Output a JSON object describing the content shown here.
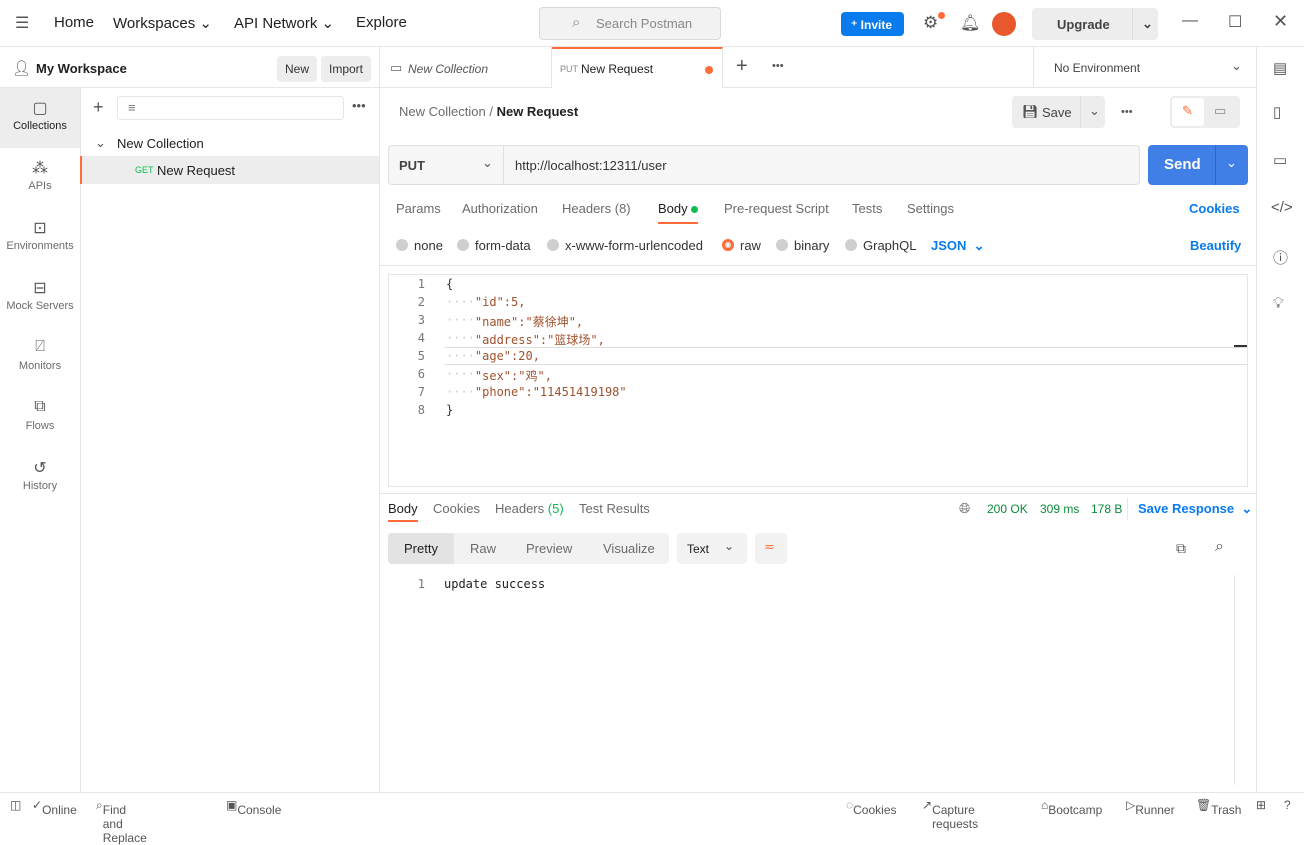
{
  "topbar": {
    "nav": [
      "Home",
      "Workspaces",
      "API Network",
      "Explore"
    ],
    "search_placeholder": "Search Postman",
    "invite": "Invite",
    "upgrade": "Upgrade"
  },
  "sidebar": {
    "workspace": "My Workspace",
    "new": "New",
    "import": "Import",
    "collection": "New Collection",
    "request_method": "GET",
    "request_name": "New Request"
  },
  "rail": [
    {
      "label": "Collections",
      "icon": "collections-icon"
    },
    {
      "label": "APIs",
      "icon": "apis-icon"
    },
    {
      "label": "Environments",
      "icon": "environments-icon"
    },
    {
      "label": "Mock Servers",
      "icon": "mock-servers-icon"
    },
    {
      "label": "Monitors",
      "icon": "monitors-icon"
    },
    {
      "label": "Flows",
      "icon": "flows-icon"
    },
    {
      "label": "History",
      "icon": "history-icon"
    }
  ],
  "tabs": [
    {
      "label": "New Collection"
    },
    {
      "method": "PUT",
      "label": "New Request"
    }
  ],
  "environment": "No Environment",
  "breadcrumb": {
    "parent": "New Collection",
    "sep": "/",
    "current": "New Request"
  },
  "save": "Save",
  "request": {
    "method": "PUT",
    "url": "http://localhost:12311/user",
    "send": "Send"
  },
  "req_tabs": [
    "Params",
    "Authorization",
    "Headers (8)",
    "Body",
    "Pre-request Script",
    "Tests",
    "Settings"
  ],
  "cookies": "Cookies",
  "body_types": [
    "none",
    "form-data",
    "x-www-form-urlencoded",
    "raw",
    "binary",
    "GraphQL"
  ],
  "body_format": "JSON",
  "beautify": "Beautify",
  "code_lines": [
    "{",
    "    \"id\":5,",
    "    \"name\":\"蔡徐坤\",",
    "    \"address\":\"篮球场\",",
    "    \"age\":20,",
    "    \"sex\":\"鸡\",",
    "    \"phone\":\"11451419198\"",
    "}"
  ],
  "response": {
    "tabs": [
      "Body",
      "Cookies",
      "Headers",
      "(5)",
      "Test Results"
    ],
    "status": "200 OK",
    "time": "309 ms",
    "size": "178 B",
    "save_response": "Save Response",
    "views": [
      "Pretty",
      "Raw",
      "Preview",
      "Visualize"
    ],
    "format": "Text",
    "lines": [
      "update success"
    ]
  },
  "statusbar": {
    "online": "Online",
    "find": "Find and Replace",
    "console": "Console",
    "cookies": "Cookies",
    "capture": "Capture requests",
    "bootcamp": "Bootcamp",
    "runner": "Runner",
    "trash": "Trash"
  },
  "colors": {
    "accent": "#ff6c37",
    "blue": "#097bed",
    "send": "#3f7fe6"
  }
}
